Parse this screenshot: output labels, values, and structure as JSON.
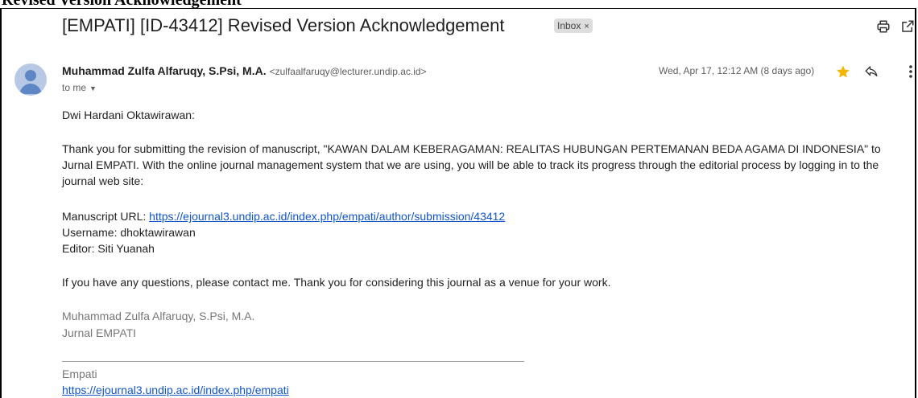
{
  "background_text": "Revised Version Acknowledgement",
  "email": {
    "subject": "[EMPATI] [ID-43412] Revised Version Acknowledgement",
    "label": "Inbox",
    "label_close": "×",
    "sender_name": "Muhammad Zulfa Alfaruqy, S.Psi, M.A.",
    "sender_email": "<zulfaalfaruqy@lecturer.undip.ac.id>",
    "recipient": "to me",
    "date": "Wed, Apr 17, 12:12 AM (8 days ago)",
    "starred": true,
    "greeting": "Dwi Hardani Oktawirawan:",
    "paragraph1": "Thank you for submitting the revision of manuscript, \"KAWAN DALAM KEBERAGAMAN: REALITAS HUBUNGAN PERTEMANAN BEDA AGAMA DI INDONESIA\" to Jurnal EMPATI. With the online journal management system that we are using, you will be able to track its progress through the editorial process by logging in to the journal web site:",
    "manuscript_label": "Manuscript URL:",
    "manuscript_url": "https://ejournal3.undip.ac.id/index.php/empati/author/submission/43412",
    "username_line": "Username: dhoktawirawan",
    "editor_line": "Editor: Siti Yuanah",
    "closing": "If you have any questions, please contact me. Thank you for considering this journal as a venue for your work.",
    "signature_name": "Muhammad Zulfa Alfaruqy, S.Psi, M.A.",
    "signature_journal": "Jurnal EMPATI",
    "footer_title": "Empati",
    "footer_url": "https://ejournal3.undip.ac.id/index.php/empati"
  },
  "colors": {
    "link": "#1155cc",
    "star": "#f4b400",
    "avatar": "#b7c9e4"
  },
  "icons": [
    "print-icon",
    "open-in-new-window-icon",
    "star-icon",
    "reply-icon",
    "more-vert-icon",
    "person-avatar-icon"
  ]
}
